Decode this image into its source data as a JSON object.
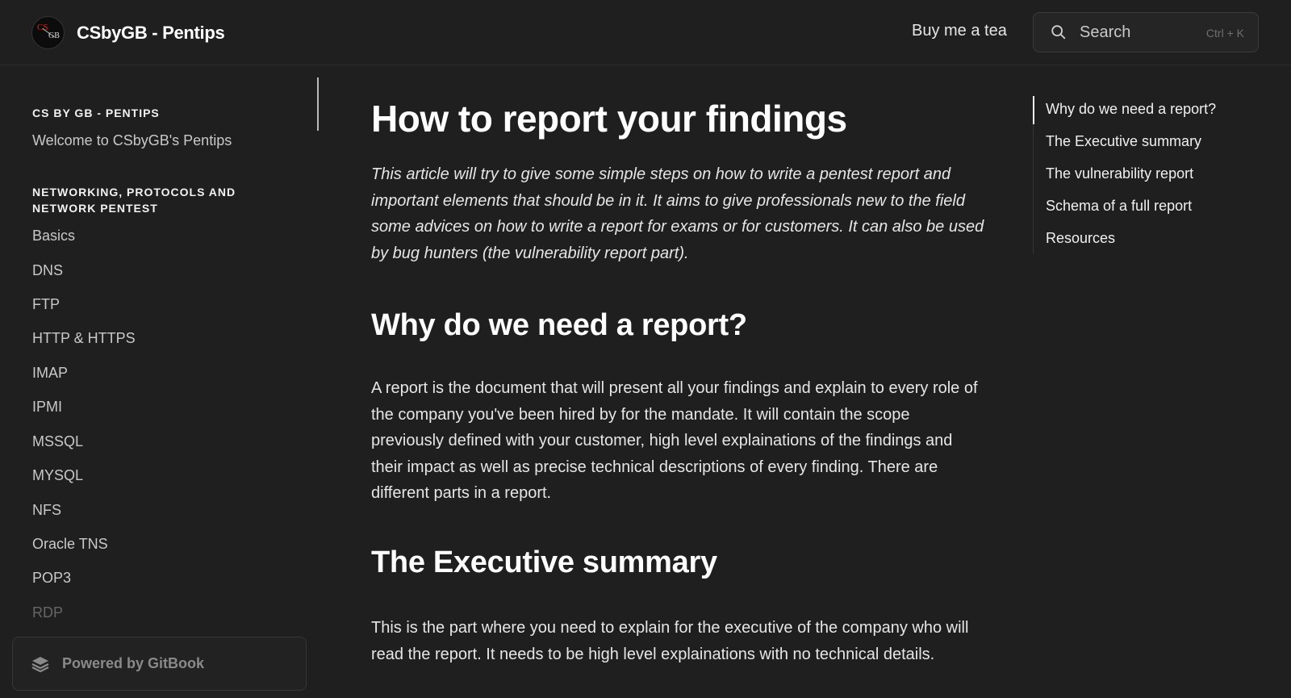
{
  "header": {
    "site_title": "CSbyGB - Pentips",
    "logo_text_top": "CS",
    "logo_text_bottom": "GB",
    "buy_link": "Buy me a tea",
    "search_label": "Search",
    "search_shortcut": "Ctrl + K"
  },
  "sidebar": {
    "section1_title": "CS BY GB - PENTIPS",
    "section1_items": [
      "Welcome to CSbyGB's Pentips"
    ],
    "section2_title": "NETWORKING, PROTOCOLS AND NETWORK PENTEST",
    "section2_items": [
      "Basics",
      "DNS",
      "FTP",
      "HTTP & HTTPS",
      "IMAP",
      "IPMI",
      "MSSQL",
      "MYSQL",
      "NFS",
      "Oracle TNS",
      "POP3",
      "RDP"
    ],
    "powered_by": "Powered by GitBook"
  },
  "main": {
    "title": "How to report your findings",
    "lead": "This article will try to give some simple steps on how to write a pentest report and important elements that should be in it. It aims to give professionals new to the field some advices on how to write a report for exams or for customers. It can also be used by bug hunters (the vulnerability report part).",
    "section1_heading": "Why do we need a report?",
    "section1_body": "A report is the document that will present all your findings and explain to every role of the company you've been hired by for the mandate. It will contain the scope previously defined with your customer, high level explainations of the findings and their impact as well as precise technical descriptions of every finding. There are different parts in a report.",
    "section2_heading": "The Executive summary",
    "section2_body": "This is the part where you need to explain for the executive of the company who will read the report. It needs to be high level explainations with no technical details."
  },
  "toc": {
    "items": [
      "Why do we need a report?",
      "The Executive summary",
      "The vulnerability report",
      "Schema of a full report",
      "Resources"
    ],
    "active_index": 0
  },
  "colors": {
    "background": "#1f1f1f",
    "text": "#e8e8e8",
    "muted": "#c9c9c9",
    "logo_red": "#d3261f"
  }
}
